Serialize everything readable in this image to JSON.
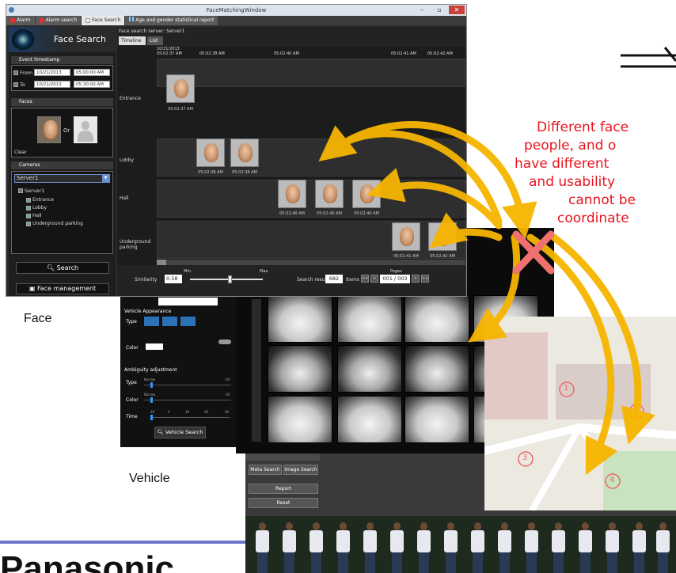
{
  "face_window": {
    "title": "FaceMatchingWindow",
    "tabs": [
      {
        "label": "Alarm",
        "active": false
      },
      {
        "label": "Alarm search",
        "active": false
      },
      {
        "label": "Face Search",
        "active": true
      },
      {
        "label": "Age and gender statistical report",
        "active": false
      }
    ],
    "header_title": "Face Search",
    "event_section": "Event timestamp",
    "from_label": "From",
    "from_date": "10/21/2013",
    "from_time": "05:00:00 AM",
    "to_label": "To",
    "to_date": "10/21/2013",
    "to_time": "05:30:00 AM",
    "faces_section": "Faces",
    "or_label": "Or",
    "clear_label": "Clear",
    "cameras_section": "Cameras",
    "server_select": "Server1",
    "tree_server": "Server1",
    "tree_cameras": [
      "Entrance",
      "Lobby",
      "Hall",
      "Underground parking"
    ],
    "search_button": "Search",
    "face_mgmt_button": "Face management",
    "server_label": "Face search server: Server1",
    "view_tabs": [
      "Timeline",
      "List"
    ],
    "time_headers": [
      "10/21/2013\n05:02:37 AM",
      "05:02:38 AM",
      "05:02:40 AM",
      "05:02:41 AM",
      "05:02:42 AM"
    ],
    "rows": [
      "Entrance",
      "Lobby",
      "Hall",
      "Underground\nparking"
    ],
    "timestamps": {
      "entrance": "05:02:37 AM",
      "lobby": [
        "05:02:38 AM",
        "05:02:38 AM"
      ],
      "hall": [
        "05:02:40 AM",
        "05:02:40 AM",
        "05:02:40 AM"
      ],
      "underground": [
        "05:02:41 AM",
        "05:02:42 AM"
      ]
    },
    "similarity_label": "Similarity",
    "similarity_value": "0.58",
    "min_label": "Min.",
    "max_label": "Max.",
    "search_result_label": "Search result",
    "search_result_value": "682",
    "items_label": "Items",
    "pages_label": "Pages",
    "page_value": "001 / 003"
  },
  "vehicle_window": {
    "appearance_label": "Vehicle Appearance",
    "type_label": "Type",
    "color_label": "Color",
    "ambiguity_label": "Ambiguity adjustment",
    "amb_type": "Type",
    "amb_color": "Color",
    "amb_time": "Time",
    "narrow": "Narrow",
    "all": "All",
    "time_ticks": [
      "10",
      "5",
      "10",
      "20",
      "30"
    ],
    "search_button": "Vehicle Search"
  },
  "person_window": {
    "meta_search": "Meta Search",
    "image_search": "Image Search",
    "report": "Report",
    "reset": "Reset"
  },
  "map": {
    "markers": [
      "1",
      "2",
      "3",
      "4"
    ]
  },
  "labels": {
    "face": "Face",
    "vehicle": "Vehicle",
    "brand": "Panasonic"
  },
  "annotation_lines": [
    "Different face",
    "people, and o",
    "have different",
    "and usability",
    "cannot be",
    "coordinate"
  ],
  "colors": {
    "annotation": "#e8141f",
    "arrow": "#f7b500",
    "cross": "#f07070"
  }
}
